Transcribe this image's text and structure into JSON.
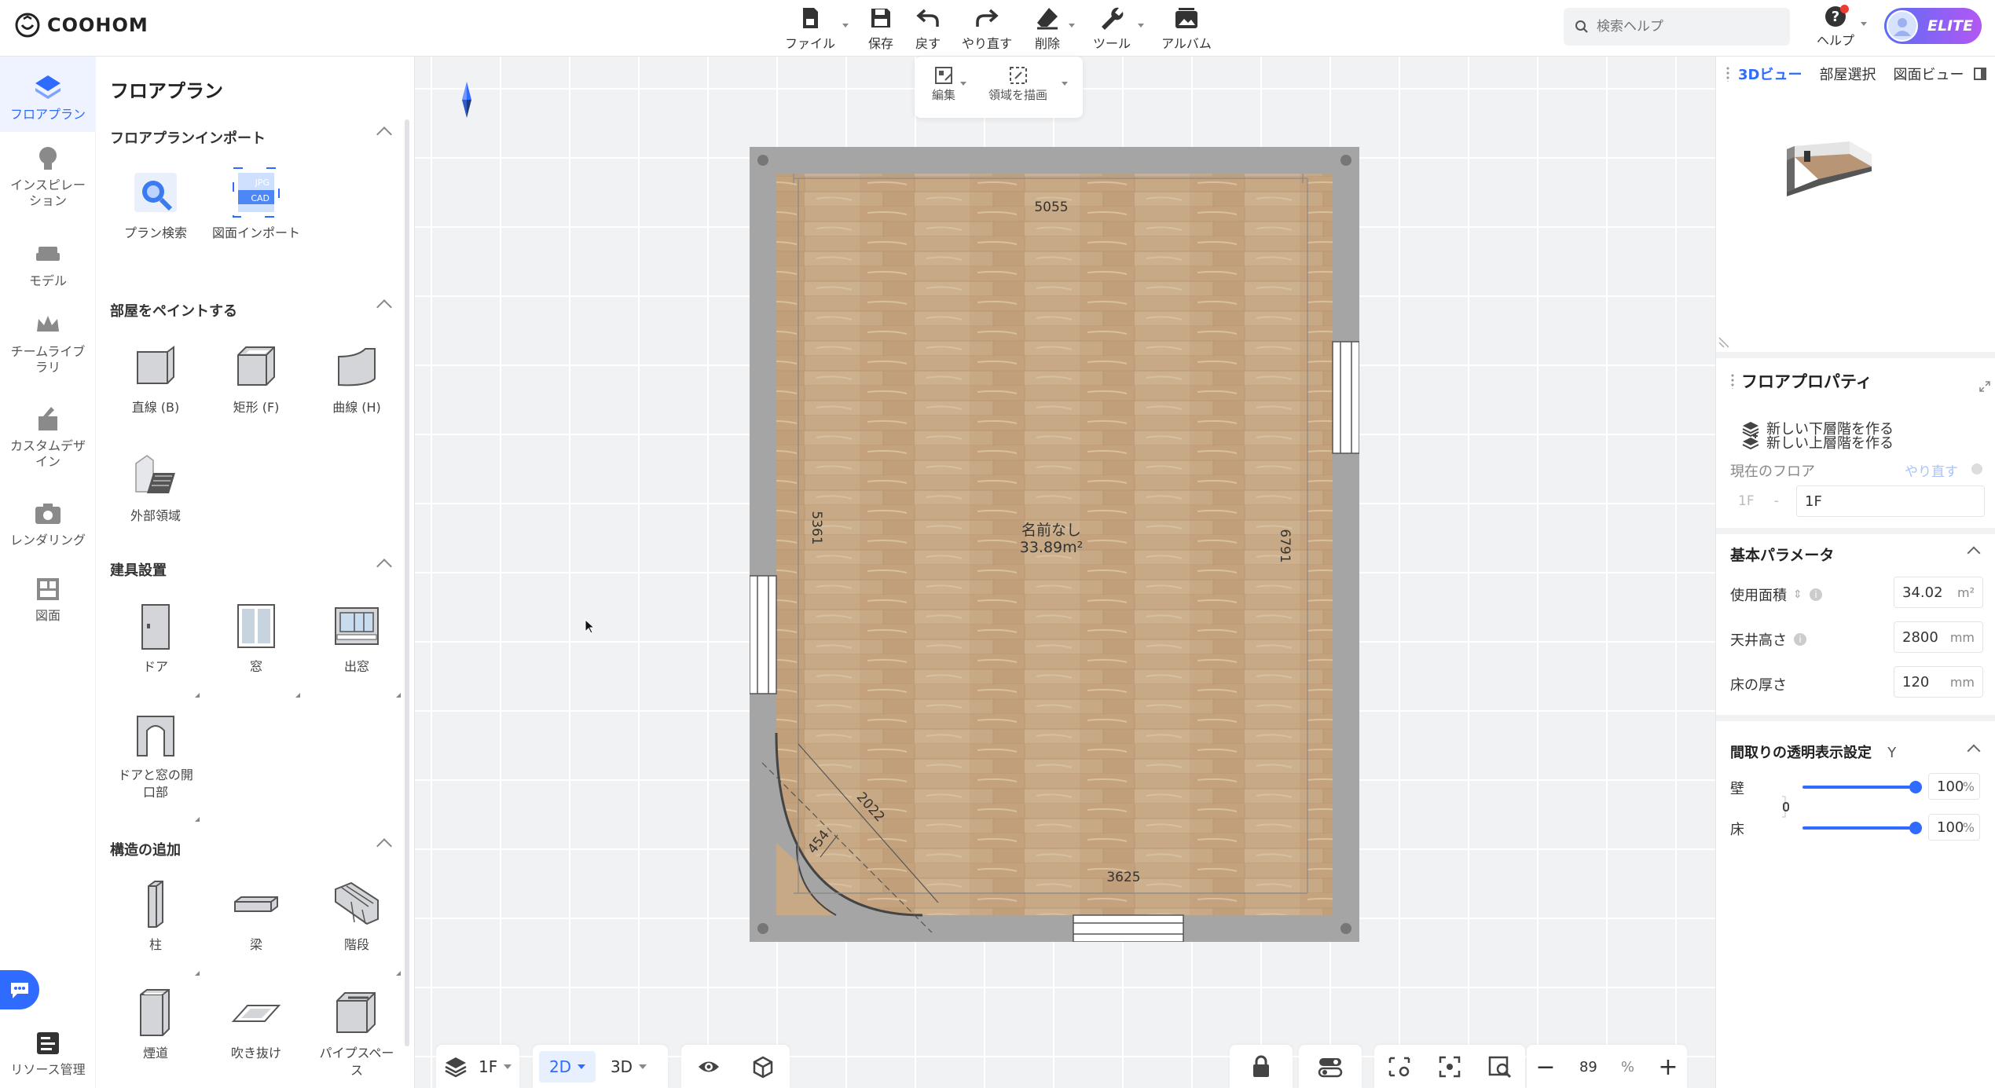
{
  "app": {
    "logo_text": "COOHOM"
  },
  "toolbar": {
    "file": "ファイル",
    "save": "保存",
    "undo": "戻す",
    "redo": "やり直す",
    "delete": "削除",
    "tools": "ツール",
    "album": "アルバム"
  },
  "search": {
    "placeholder": "検索ヘルプ"
  },
  "help": {
    "label": "ヘルプ"
  },
  "account": {
    "badge": "ELITE"
  },
  "rail": {
    "items": [
      {
        "label": "フロアプラン"
      },
      {
        "label": "インスピレーション"
      },
      {
        "label": "モデル"
      },
      {
        "label": "チームライブラリ"
      },
      {
        "label": "カスタムデザイン"
      },
      {
        "label": "レンダリング"
      },
      {
        "label": "図面"
      },
      {
        "label": "リソース管理"
      }
    ]
  },
  "panel": {
    "title": "フロアプラン",
    "sections": [
      {
        "title": "フロアプランインポート",
        "tiles": [
          "プラン検索",
          "図面インポート"
        ]
      },
      {
        "title": "部屋をペイントする",
        "tiles": [
          "直線 (B)",
          "矩形 (F)",
          "曲線 (H)",
          "外部領域"
        ]
      },
      {
        "title": "建具設置",
        "tiles": [
          "ドア",
          "窓",
          "出窓",
          "ドアと窓の開口部"
        ]
      },
      {
        "title": "構造の追加",
        "tiles": [
          "柱",
          "梁",
          "階段",
          "煙道",
          "吹き抜け",
          "パイプスペース"
        ]
      }
    ],
    "import_icon_text": {
      "jpg": "JPG",
      "cad": "CAD"
    }
  },
  "canvas_tools": {
    "edit": "編集",
    "draw_area": "領域を描画"
  },
  "plan": {
    "room_name": "名前なし",
    "room_area": "33.89m²",
    "dims": {
      "top": "5055",
      "left": "5361",
      "right": "6791",
      "bottom": "3625",
      "diag": "2022",
      "small": "454"
    }
  },
  "bottombar": {
    "floor": "1F",
    "mode_2d": "2D",
    "mode_3d": "3D",
    "zoom_value": "89",
    "zoom_unit": "%"
  },
  "rpanel": {
    "tabs": [
      "3Dビュー",
      "部屋選択",
      "図面ビュー"
    ],
    "props_title": "フロアプロパティ",
    "new_upper": "新しい上層階を作る",
    "new_lower": "新しい下層階を作る",
    "current_floor_label": "現在のフロア",
    "redo_link": "やり直す",
    "floor_prefix": "1F",
    "floor_name": "1F",
    "basic_params": "基本パラメータ",
    "usable_area_label": "使用面積",
    "usable_area_value": "34.02",
    "usable_area_unit": "m²",
    "ceiling_label": "天井高さ",
    "ceiling_value": "2800",
    "ceiling_unit": "mm",
    "floor_thick_label": "床の厚さ",
    "floor_thick_value": "120",
    "floor_thick_unit": "mm",
    "transparency_title": "間取りの透明表示設定",
    "transparency_key": "Y",
    "wall_label": "壁",
    "wall_value": "100",
    "floor_label": "床",
    "floor_value": "100",
    "pct": "%",
    "wall_transparency_fraction": 1.0,
    "floor_transparency_fraction": 1.0
  },
  "colors": {
    "accent": "#2f6bff",
    "wall": "#a5a5a5",
    "floor_wood": "#c9ab87"
  }
}
